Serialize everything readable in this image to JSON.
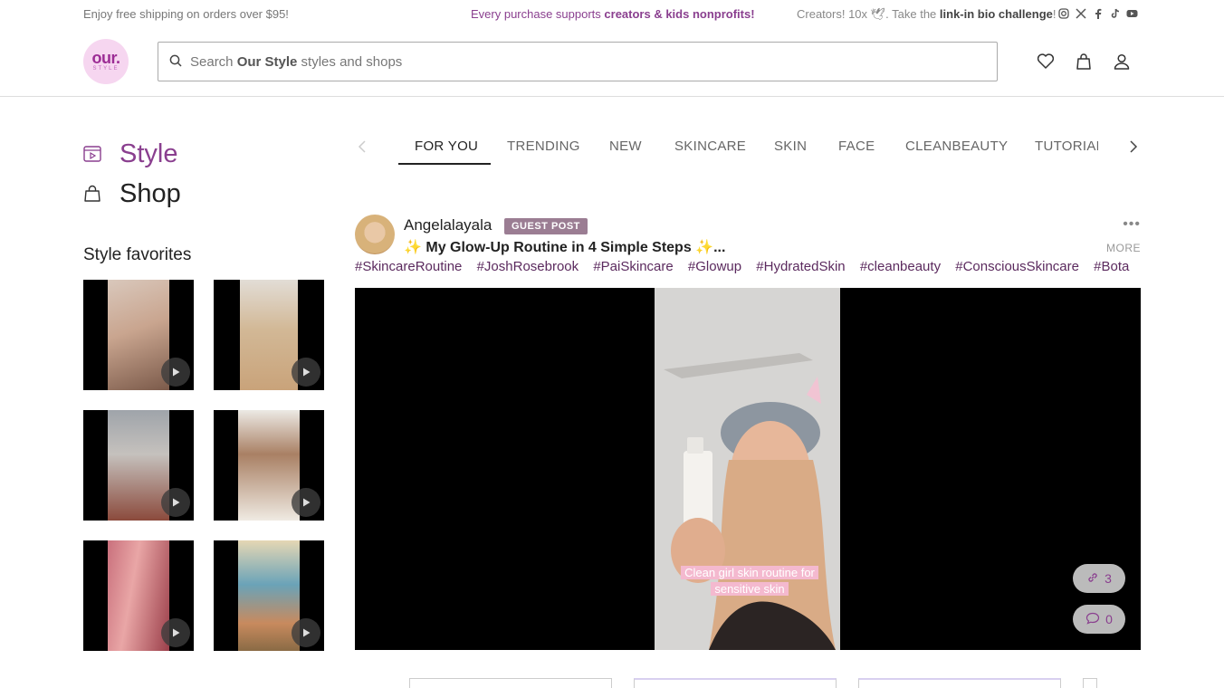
{
  "topbar": {
    "shipping": "Enjoy free shipping on orders over $95!",
    "mission_prefix": "Every purchase supports ",
    "mission_bold": "creators & kids nonprofits!",
    "creators_prefix": "Creators! 10x 🕊. Take the ",
    "creators_bold": "link-in bio challenge",
    "creators_suffix": "!",
    "socials": [
      "instagram-icon",
      "x-icon",
      "facebook-icon",
      "tiktok-icon",
      "youtube-icon"
    ]
  },
  "header": {
    "logo_line1": "our.",
    "logo_line2": "STYLE",
    "search_prefix": "Search ",
    "search_bold": "Our Style",
    "search_suffix": " styles and shops",
    "icons": [
      "heart-icon",
      "bag-icon",
      "user-icon"
    ]
  },
  "sidebar": {
    "nav": [
      {
        "label": "Style",
        "icon": "style-play-icon",
        "active": true
      },
      {
        "label": "Shop",
        "icon": "bag-icon",
        "active": false
      }
    ],
    "favorites_title": "Style favorites",
    "favorites": [
      "favorite-1",
      "favorite-2",
      "favorite-3",
      "favorite-4",
      "favorite-5",
      "favorite-6"
    ]
  },
  "tabs": [
    "FOR YOU",
    "TRENDING",
    "NEW",
    "SKINCARE",
    "SKIN",
    "FACE",
    "CLEANBEAUTY",
    "TUTORIAL"
  ],
  "post": {
    "author": "Angelalayala",
    "badge": "GUEST POST",
    "title": "✨ My Glow-Up Routine in 4 Simple Steps ✨...",
    "more": "MORE",
    "hashtags": [
      "#SkincareRoutine",
      "#JoshRosebrook",
      "#PaiSkincare",
      "#Glowup",
      "#HydratedSkin",
      "#cleanbeauty",
      "#ConsciousSkincare",
      "#Bota"
    ],
    "caption_line1": "Clean girl skin routine for",
    "caption_line2": "sensitive skin",
    "links_count": "3",
    "comments_count": "0"
  },
  "colors": {
    "brand": "#8a3f8f",
    "logo_bg": "#f6d6f0",
    "badge": "#9b7d93",
    "hashtag": "#5b2a5e"
  }
}
